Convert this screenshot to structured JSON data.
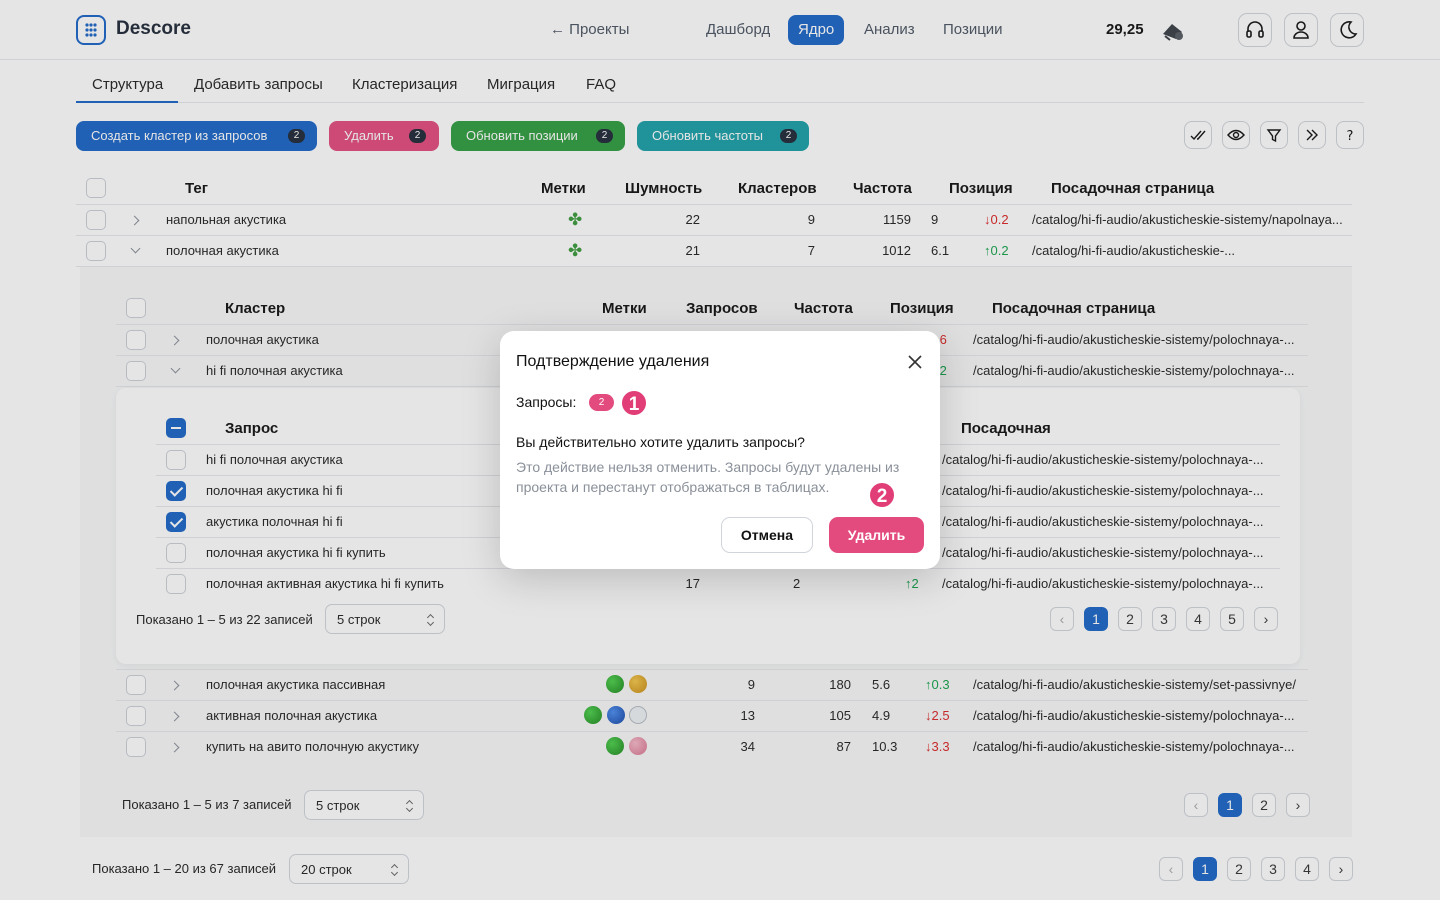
{
  "brand": {
    "name": "Descore"
  },
  "header": {
    "back_link": "← Проекты",
    "nav": [
      "Дашборд",
      "Ядро",
      "Анализ",
      "Позиции"
    ],
    "nav_active": "Ядро",
    "balance": "29,25"
  },
  "tabs": [
    "Структура",
    "Добавить запросы",
    "Кластеризация",
    "Миграция",
    "FAQ"
  ],
  "actions": [
    {
      "label": "Создать кластер из запросов",
      "count": "2",
      "color": "#1a66c9"
    },
    {
      "label": "Удалить",
      "count": "2",
      "color": "#e34b7f"
    },
    {
      "label": "Обновить позиции",
      "count": "2",
      "color": "#2f9e3f"
    },
    {
      "label": "Обновить частоты",
      "count": "2",
      "color": "#1aa0a8"
    }
  ],
  "tag_table": {
    "headers": {
      "tag": "Тег",
      "marks": "Метки",
      "noise": "Шумность",
      "clusters": "Кластеров",
      "freq": "Частота",
      "pos": "Позиция",
      "page": "Посадочная страница"
    },
    "rows": [
      {
        "tag": "напольная акустика",
        "noise": "22",
        "clusters": "9",
        "freq": "1159",
        "pos": "9",
        "delta": "↓0.2",
        "page": "/catalog/hi-fi-audio/akusticheskie-sistemy/napolnaya..."
      },
      {
        "tag": "полочная акустика",
        "noise": "21",
        "clusters": "7",
        "freq": "1012",
        "pos": "6.1",
        "delta": "↑0.2",
        "page": "/catalog/hi-fi-audio/akusticheskie-..."
      }
    ],
    "footer": "Показано 1 – 20 из 67 записей",
    "rows_select": "20 строк",
    "pages": [
      "1",
      "2",
      "3",
      "4"
    ]
  },
  "cluster_table": {
    "headers": {
      "cluster": "Кластер",
      "marks": "Метки",
      "queries": "Запросов",
      "freq": "Частота",
      "pos": "Позиция",
      "page": "Посадочная страница"
    },
    "rows": [
      {
        "name": "полочная акустика",
        "delta": ".6",
        "page": "/catalog/hi-fi-audio/akusticheskie-sistemy/polochnaya-..."
      },
      {
        "name": "hi fi полочная акустика",
        "delta": ".2",
        "page": "/catalog/hi-fi-audio/akusticheskie-sistemy/polochnaya-..."
      },
      {
        "name": "полочная акустика пассивная",
        "queries": "9",
        "freq": "180",
        "pos": "5.6",
        "delta": "↑0.3",
        "page": "/catalog/hi-fi-audio/akusticheskie-sistemy/set-passivnye/"
      },
      {
        "name": "активная полочная акустика",
        "queries": "13",
        "freq": "105",
        "pos": "4.9",
        "delta": "↓2.5",
        "page": "/catalog/hi-fi-audio/akusticheskie-sistemy/polochnaya-..."
      },
      {
        "name": "купить на авито полочную акустику",
        "queries": "34",
        "freq": "87",
        "pos": "10.3",
        "delta": "↓3.3",
        "page": "/catalog/hi-fi-audio/akusticheskie-sistemy/polochnaya-..."
      }
    ],
    "footer": "Показано 1 – 5 из 7 записей",
    "rows_select": "5 строк",
    "pages": [
      "1",
      "2"
    ]
  },
  "query_table": {
    "headers": {
      "query": "Запрос",
      "page": "Посадочная"
    },
    "rows": [
      {
        "name": "hi fi полочная акустика",
        "page": "/catalog/hi-fi-audio/akusticheskie-sistemy/polochnaya-..."
      },
      {
        "name": "полочная акустика hi fi",
        "page": "/catalog/hi-fi-audio/akusticheskie-sistemy/polochnaya-..."
      },
      {
        "name": "акустика полочная hi fi",
        "page": "/catalog/hi-fi-audio/akusticheskie-sistemy/polochnaya-..."
      },
      {
        "name": "полочная акустика hi fi купить",
        "page": "/catalog/hi-fi-audio/akusticheskie-sistemy/polochnaya-..."
      },
      {
        "name": "полочная активная акустика hi fi купить",
        "freq": "17",
        "pos": "2",
        "delta": "↑2",
        "page": "/catalog/hi-fi-audio/akusticheskie-sistemy/polochnaya-..."
      }
    ],
    "footer": "Показано 1 – 5 из 22 записей",
    "rows_select": "5 строк",
    "pages": [
      "1",
      "2",
      "3",
      "4",
      "5"
    ]
  },
  "modal": {
    "title": "Подтверждение удаления",
    "queries_label": "Запросы:",
    "queries_count": "2",
    "question": "Вы действительно хотите удалить запросы?",
    "warning": "Это действие нельзя отменить. Запросы будут удалены из проекта и перестанут отображаться в таблицах.",
    "cancel": "Отмена",
    "confirm": "Удалить"
  },
  "markers": [
    "1",
    "2"
  ],
  "colors": {
    "primary": "#1a66c9",
    "danger": "#e34b7f",
    "success": "#2f9e3f",
    "teal": "#1aa0a8"
  }
}
